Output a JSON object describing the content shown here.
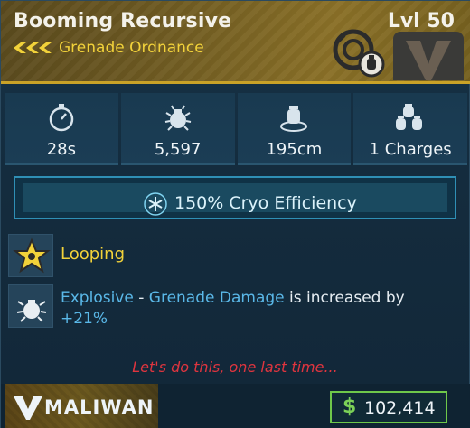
{
  "header": {
    "item_name": "Booming Recursive",
    "item_type": "Grenade Ordnance",
    "level": "Lvl 50",
    "rarity_color": "#f2d23a",
    "icons": [
      "rarity-chevrons-icon",
      "grenade-type-icon",
      "manufacturer-emblem"
    ]
  },
  "stats": [
    {
      "icon": "timer-icon",
      "value": "28s"
    },
    {
      "icon": "damage-icon",
      "value": "5,597"
    },
    {
      "icon": "radius-icon",
      "value": "195cm"
    },
    {
      "icon": "charges-icon",
      "value": "1 Charges"
    }
  ],
  "element": {
    "icon": "cryo-snowflake-icon",
    "text": "150% Cryo Efficiency",
    "color": "#5ab8e8"
  },
  "perks": {
    "perk1": {
      "icon": "star-burst-icon",
      "label": "Looping"
    },
    "perk2": {
      "icon": "explosive-icon",
      "kw1": "Explosive",
      "sep": " - ",
      "kw2": "Grenade Damage",
      "mid": " is increased by",
      "value": "+21%"
    }
  },
  "flavor_text": "Let's do this, one last time...",
  "footer": {
    "manufacturer": "MALIWAN",
    "currency_icon": "$",
    "price": "102,414",
    "price_color": "#7bd157"
  }
}
